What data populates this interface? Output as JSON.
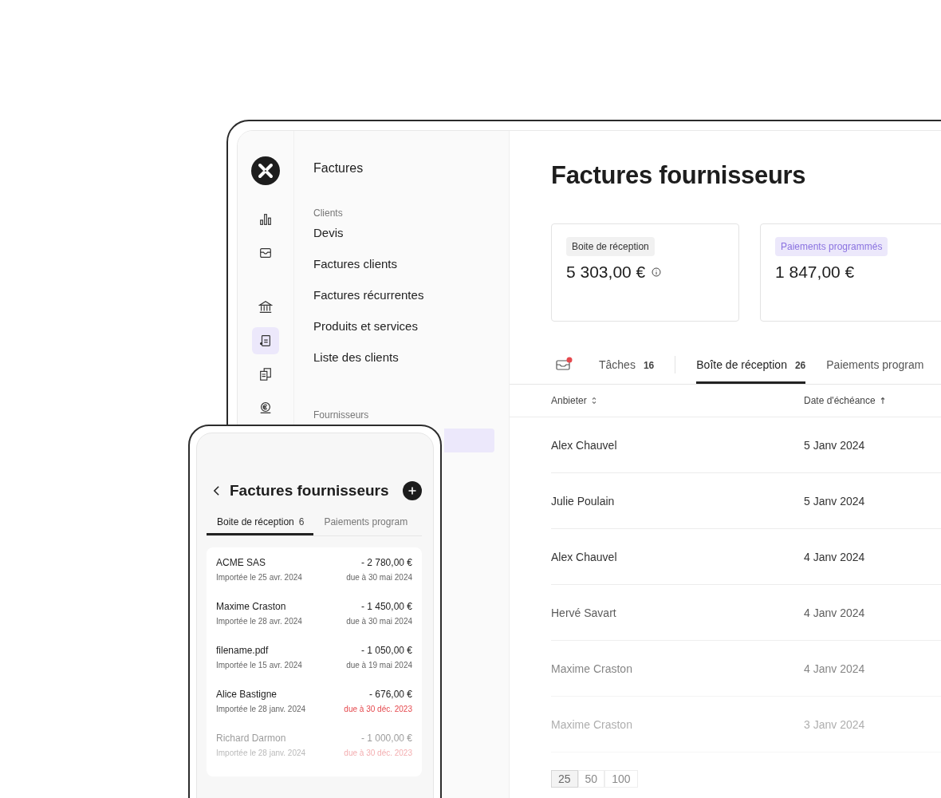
{
  "rail_items": [
    {
      "selected": false
    },
    {
      "selected": false
    },
    {
      "selected": false
    },
    {
      "selected": true
    },
    {
      "selected": false
    },
    {
      "selected": false
    }
  ],
  "nav": {
    "title": "Factures",
    "groups": [
      {
        "heading": "Clients",
        "items": [
          {
            "label": "Devis",
            "selected": false
          },
          {
            "label": "Factures clients",
            "selected": false
          },
          {
            "label": "Factures récurrentes",
            "selected": false
          },
          {
            "label": "Produits et services",
            "selected": false
          },
          {
            "label": "Liste des clients",
            "selected": false
          }
        ]
      },
      {
        "heading": "Fournisseurs",
        "items": [
          {
            "selected": true
          }
        ]
      }
    ]
  },
  "main": {
    "title": "Factures fournisseurs",
    "cards": [
      {
        "kind": "neutral",
        "tag": "Boite de réception",
        "amount": "5 303,00 €",
        "info": true
      },
      {
        "kind": "accent",
        "tag": "Paiements programmés",
        "amount": "1 847,00 €",
        "info": false
      }
    ],
    "tabs": [
      {
        "kind": "icon",
        "notification": true,
        "selected": false
      },
      {
        "kind": "text",
        "label": "Tâches",
        "count": "16",
        "selected": false
      },
      {
        "kind": "divider"
      },
      {
        "kind": "text",
        "label": "Boîte de réception",
        "count": "26",
        "selected": true
      },
      {
        "kind": "text",
        "label": "Paiements program",
        "selected": false
      }
    ],
    "table": {
      "columns": [
        {
          "label": "Anbieter",
          "kind": "sortable"
        },
        {
          "label": "Date d'échéance",
          "kind": "ascending"
        }
      ],
      "rows": [
        {
          "supplier": "Alex Chauvel",
          "due": "5 Janv 2024"
        },
        {
          "supplier": "Julie Poulain",
          "due": "5 Janv 2024"
        },
        {
          "supplier": "Alex Chauvel",
          "due": "4 Janv 2024"
        },
        {
          "supplier": "Hervé Savart",
          "due": "4 Janv 2024"
        },
        {
          "supplier": "Maxime Craston",
          "due": "4 Janv 2024"
        },
        {
          "supplier": "Maxime Craston",
          "due": "3 Janv 2024"
        }
      ]
    },
    "page_sizes": [
      {
        "label": "25",
        "selected": true
      },
      {
        "label": "50",
        "selected": false
      },
      {
        "label": "100",
        "selected": false
      }
    ]
  },
  "mobile": {
    "title": "Factures fournisseurs",
    "tabs": [
      {
        "label": "Boite de réception",
        "count": "6",
        "selected": true
      },
      {
        "label": "Paiements program",
        "selected": false
      }
    ],
    "invoices": [
      {
        "name": "ACME SAS",
        "amount": "- 2 780,00 €",
        "imported": "Importée le 25 avr. 2024",
        "due": "due à 30 mai 2024",
        "overdue": false
      },
      {
        "name": "Maxime Craston",
        "amount": "- 1 450,00 €",
        "imported": "Importée le 28 avr. 2024",
        "due": "due à 30 mai 2024",
        "overdue": false
      },
      {
        "name": "filename.pdf",
        "amount": "- 1 050,00 €",
        "imported": "Importée le 15 avr. 2024",
        "due": "due à 19 mai 2024",
        "overdue": false
      },
      {
        "name": "Alice Bastigne",
        "amount": "- 676,00 €",
        "imported": "Importée le 28 janv. 2024",
        "due": "due à 30 déc. 2023",
        "overdue": true
      },
      {
        "name": "Richard Darmon",
        "amount": "- 1 000,00 €",
        "imported": "Importée le 28 janv. 2024",
        "due": "due à 30 déc. 2023",
        "overdue": true
      }
    ]
  }
}
